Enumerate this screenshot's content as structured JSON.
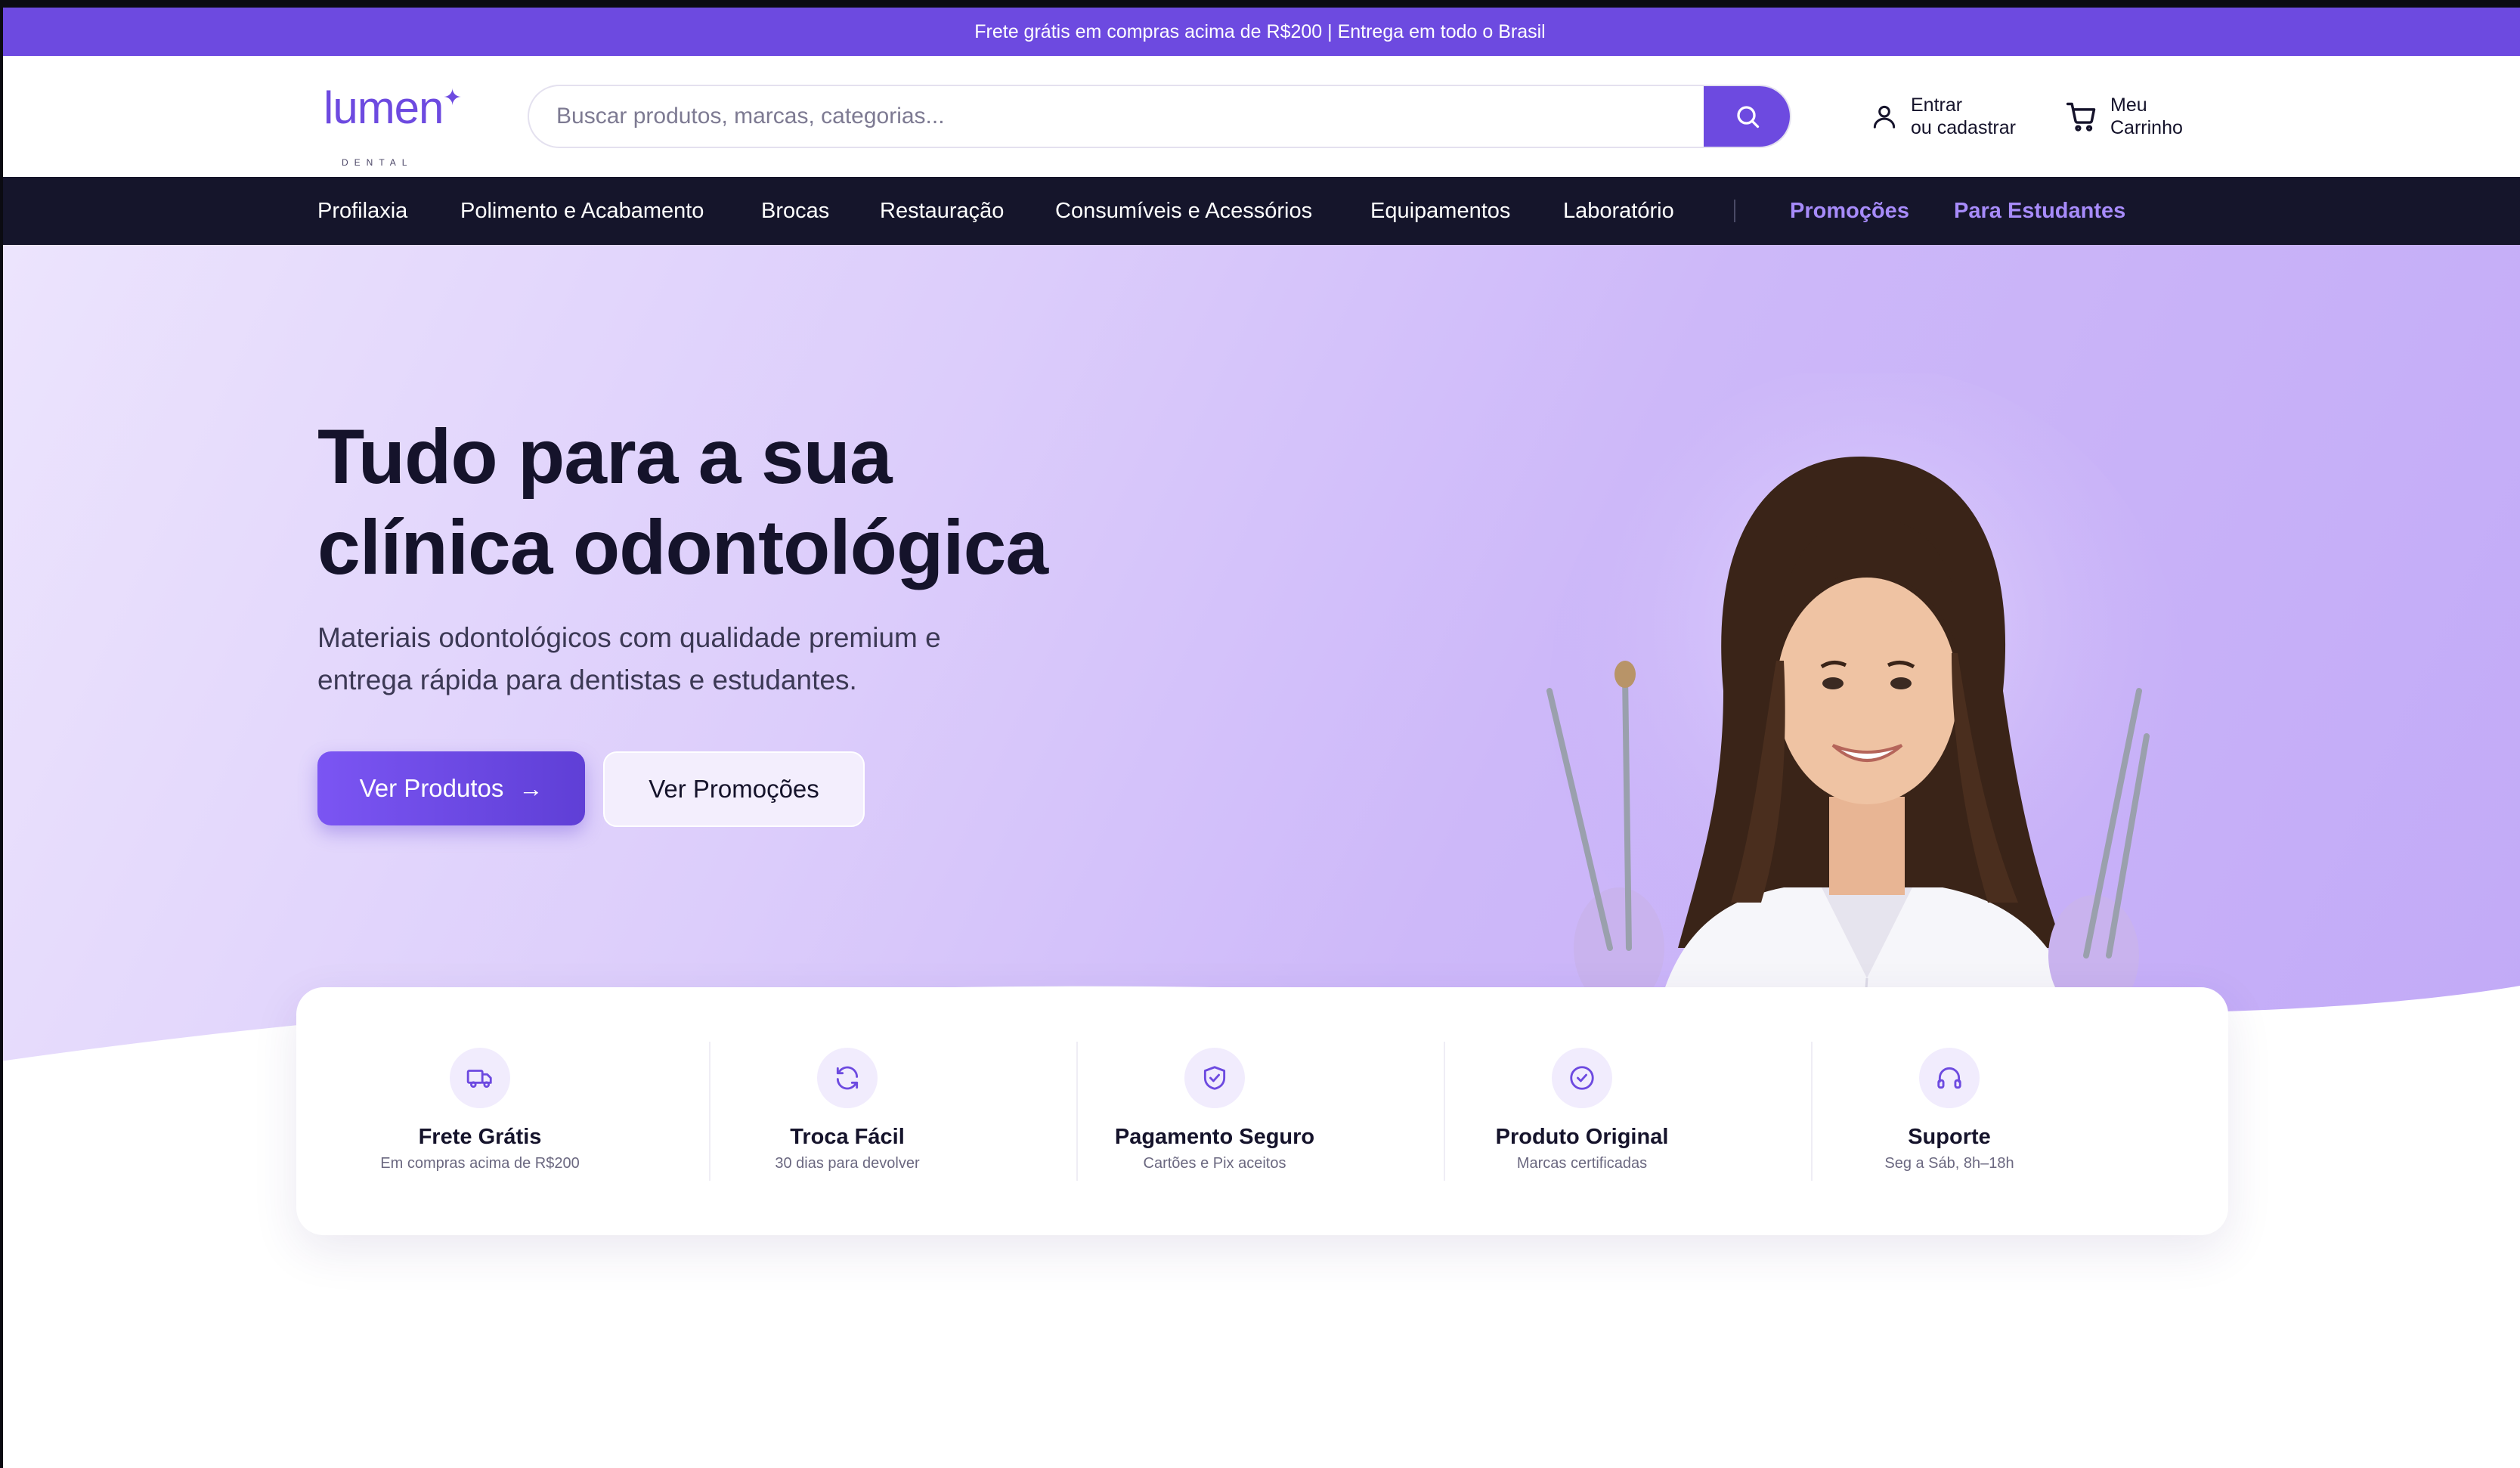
{
  "announcement": "Frete grátis em compras acima de R$200 | Entrega em todo o Brasil",
  "brand": {
    "name": "lumen",
    "tagline": "DENTAL",
    "color": "#6d4ae0"
  },
  "search": {
    "placeholder": "Buscar produtos, marcas, categorias...",
    "value": "",
    "icon": "search-icon"
  },
  "account": {
    "line1": "Entrar",
    "line2": "ou cadastrar",
    "icon": "user-icon"
  },
  "cart": {
    "line1": "Meu",
    "line2": "Carrinho",
    "icon": "cart-icon"
  },
  "nav": {
    "items": [
      {
        "label": "Profilaxia"
      },
      {
        "label": "Polimento e Acabamento"
      },
      {
        "label": "Brocas"
      },
      {
        "label": "Restauração"
      },
      {
        "label": "Consumíveis e Acessórios"
      },
      {
        "label": "Equipamentos"
      },
      {
        "label": "Laboratório"
      }
    ],
    "highlight": [
      {
        "label": "Promoções"
      },
      {
        "label": "Para Estudantes"
      }
    ],
    "accent_color": "#a78bfa"
  },
  "hero": {
    "title_line1": "Tudo para a sua",
    "title_line2": "clínica odontológica",
    "subtitle_line1": "Materiais odontológicos com qualidade premium e",
    "subtitle_line2": "entrega rápida para dentistas e estudantes.",
    "primary_button": "Ver Produtos",
    "primary_icon": "arrow-right-icon",
    "secondary_button": "Ver Promoções"
  },
  "features": [
    {
      "title": "Frete Grátis",
      "subtitle": "Em compras acima de R$200",
      "icon": "truck-icon"
    },
    {
      "title": "Troca Fácil",
      "subtitle": "30 dias para devolver",
      "icon": "refresh-icon"
    },
    {
      "title": "Pagamento Seguro",
      "subtitle": "Cartões e Pix aceitos",
      "icon": "shield-check-icon"
    },
    {
      "title": "Produto Original",
      "subtitle": "Marcas certificadas",
      "icon": "badge-check-icon"
    },
    {
      "title": "Suporte",
      "subtitle": "Seg a Sáb, 8h–18h",
      "icon": "headphones-icon"
    }
  ]
}
